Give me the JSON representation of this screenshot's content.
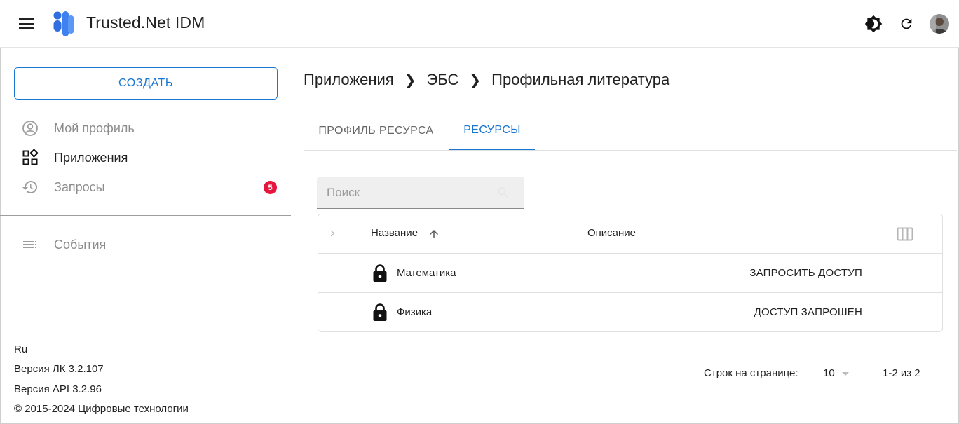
{
  "header": {
    "app_title": "Trusted.Net IDM",
    "icons": [
      "menu-icon",
      "logo-icon",
      "theme-toggle-icon",
      "refresh-icon",
      "avatar"
    ]
  },
  "sidebar": {
    "create_label": "СОЗДАТЬ",
    "items": [
      {
        "label": "Мой профиль",
        "icon": "account-circle-icon",
        "state": "muted"
      },
      {
        "label": "Приложения",
        "icon": "apps-icon",
        "state": "active"
      },
      {
        "label": "Запросы",
        "icon": "history-icon",
        "state": "muted",
        "badge": "5"
      },
      {
        "label": "События",
        "icon": "list-icon",
        "state": "muted"
      }
    ],
    "footer": {
      "language": "Ru",
      "version_lk": "Версия ЛК 3.2.107",
      "version_api": "Версия API 3.2.96",
      "copyright": "© 2015-2024 Цифровые технологии"
    }
  },
  "main": {
    "breadcrumb": [
      "Приложения",
      "ЭБС",
      "Профильная литература"
    ],
    "tabs": [
      {
        "label": "ПРОФИЛЬ РЕСУРСА",
        "active": false
      },
      {
        "label": "РЕСУРСЫ",
        "active": true
      }
    ],
    "search": {
      "placeholder": "Поиск",
      "value": ""
    },
    "table": {
      "columns": {
        "name": "Название",
        "description": "Описание"
      },
      "sort": "ascending",
      "rows": [
        {
          "name": "Математика",
          "action": "ЗАПРОСИТЬ ДОСТУП"
        },
        {
          "name": "Физика",
          "action": "ДОСТУП ЗАПРОШЕН"
        }
      ]
    },
    "pagination": {
      "rows_per_page_label": "Строк на странице:",
      "rows_per_page": "10",
      "range": "1-2 из 2"
    }
  },
  "colors": {
    "accent": "#1976d2",
    "badge": "#e5173f",
    "logo": "#2f6fe0"
  }
}
